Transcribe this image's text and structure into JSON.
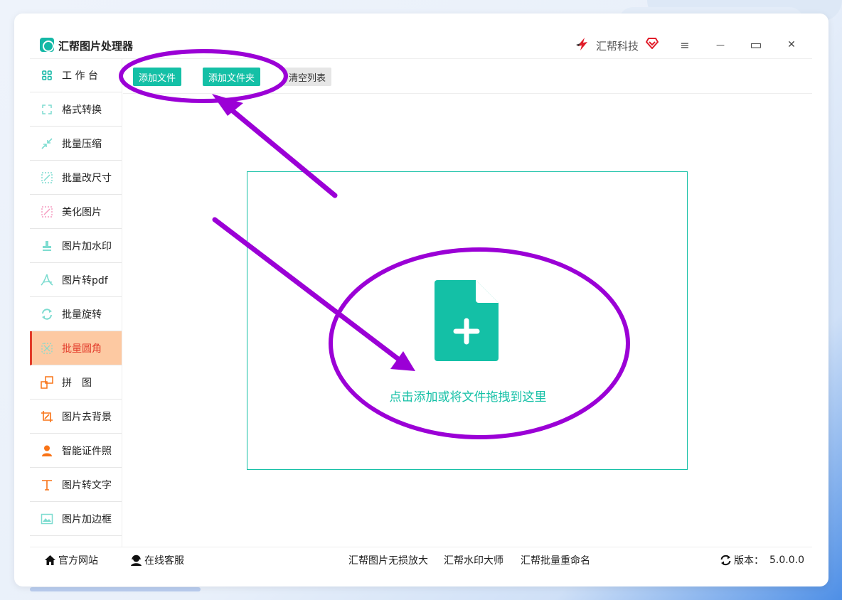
{
  "app": {
    "title": "汇帮图片处理器"
  },
  "brand": {
    "name": "汇帮科技"
  },
  "window_controls": {
    "menu": "≡",
    "minimize": "—",
    "maximize": "▭",
    "close": "✕"
  },
  "sidebar": {
    "items": [
      {
        "label": "工 作 台",
        "icon": "grid-icon",
        "color": "#14b8a6"
      },
      {
        "label": "格式转换",
        "icon": "convert-icon",
        "color": "#14b8a6"
      },
      {
        "label": "批量压缩",
        "icon": "compress-icon",
        "color": "#14b8a6"
      },
      {
        "label": "批量改尺寸",
        "icon": "resize-icon",
        "color": "#14b8a6"
      },
      {
        "label": "美化图片",
        "icon": "beautify-icon",
        "color": "#f472b6"
      },
      {
        "label": "图片加水印",
        "icon": "stamp-icon",
        "color": "#14b8a6"
      },
      {
        "label": "图片转pdf",
        "icon": "pdf-icon",
        "color": "#14b8a6"
      },
      {
        "label": "批量旋转",
        "icon": "rotate-icon",
        "color": "#14b8a6"
      },
      {
        "label": "批量圆角",
        "icon": "round-corner-icon",
        "color": "#14b8a6",
        "active": true
      },
      {
        "label": "拼　图",
        "icon": "puzzle-icon",
        "color": "#f97316"
      },
      {
        "label": "图片去背景",
        "icon": "crop-icon",
        "color": "#f97316"
      },
      {
        "label": "智能证件照",
        "icon": "person-icon",
        "color": "#f97316"
      },
      {
        "label": "图片转文字",
        "icon": "text-icon",
        "color": "#f97316"
      },
      {
        "label": "图片加边框",
        "icon": "frame-icon",
        "color": "#14b8a6"
      }
    ]
  },
  "toolbar": {
    "add_file": "添加文件",
    "add_folder": "添加文件夹",
    "clear_list": "清空列表"
  },
  "dropzone": {
    "text": "点击添加或将文件拖拽到这里"
  },
  "footer": {
    "website": "官方网站",
    "support": "在线客服",
    "link1": "汇帮图片无损放大",
    "link2": "汇帮水印大师",
    "link3": "汇帮批量重命名",
    "version_label": "版本：",
    "version": "5.0.0.0"
  },
  "colors": {
    "accent": "#14c0a6",
    "active_bg": "#fdc9a2",
    "active_text": "#e23b2a",
    "annotation": "#9b00d6"
  }
}
